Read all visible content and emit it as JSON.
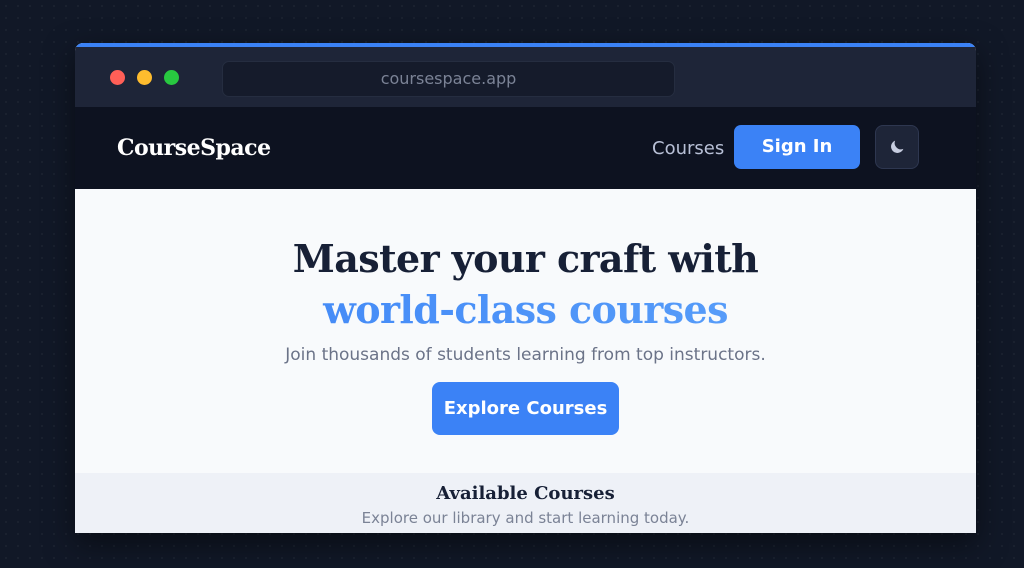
{
  "browser": {
    "url": "coursespace.app"
  },
  "navbar": {
    "brand": "CourseSpace",
    "courses_link": "Courses",
    "signin_label": "Sign In",
    "theme_toggle_icon": "moon-icon"
  },
  "hero": {
    "title_line1": "Master your craft with",
    "title_line2": "world-class courses",
    "subtitle": "Join thousands of students learning from top instructors.",
    "cta_label": "Explore Courses"
  },
  "courses_section": {
    "title": "Available Courses",
    "subtitle": "Explore our library and start learning today."
  },
  "colors": {
    "accent": "#3b82f6",
    "navbar_bg": "#0d1220",
    "page_bg": "#111827"
  }
}
